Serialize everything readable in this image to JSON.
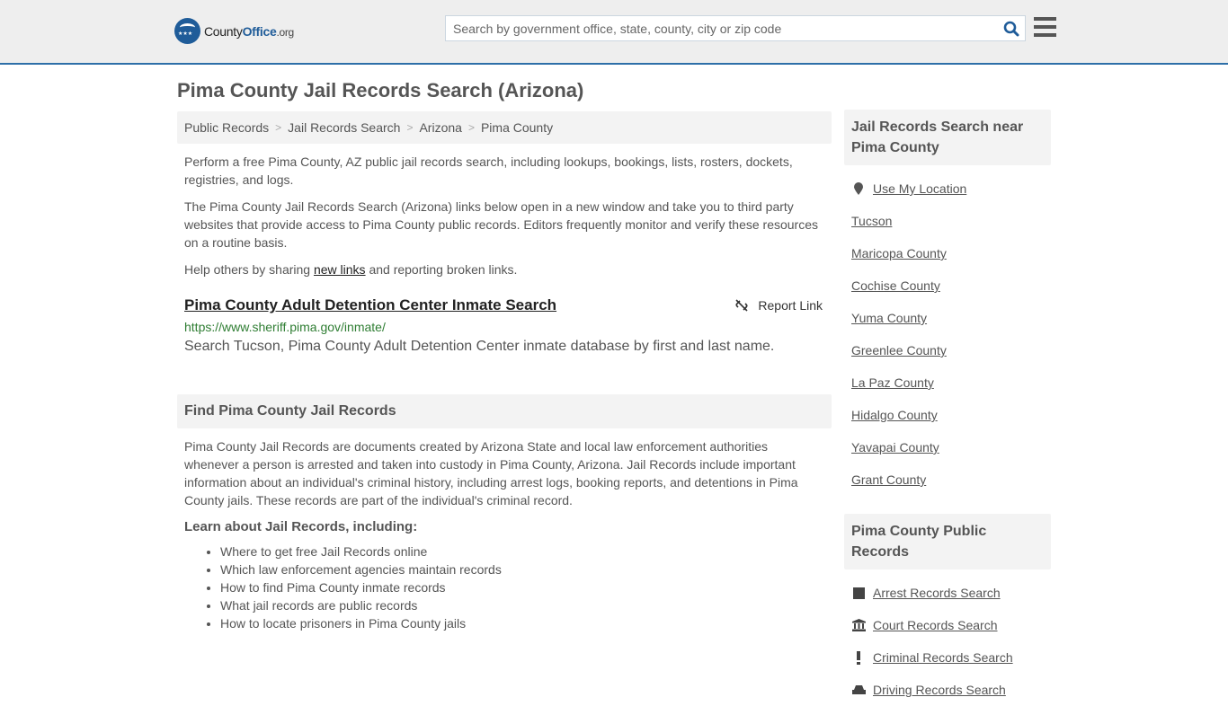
{
  "header": {
    "logo": {
      "part1": "County",
      "part2": "Office",
      "part3": ".org"
    },
    "search_placeholder": "Search by government office, state, county, city or zip code",
    "brand_color": "#1f5c99"
  },
  "page_title": "Pima County Jail Records Search (Arizona)",
  "breadcrumb": [
    {
      "label": "Public Records"
    },
    {
      "label": "Jail Records Search"
    },
    {
      "label": "Arizona"
    },
    {
      "label": "Pima County"
    }
  ],
  "intro": {
    "p1": "Perform a free Pima County, AZ public jail records search, including lookups, bookings, lists, rosters, dockets, registries, and logs.",
    "p2": "The Pima County Jail Records Search (Arizona) links below open in a new window and take you to third party websites that provide access to Pima County public records. Editors frequently monitor and verify these resources on a routine basis.",
    "p3_before": "Help others by sharing ",
    "p3_link": "new links",
    "p3_after": " and reporting broken links."
  },
  "result": {
    "title": "Pima County Adult Detention Center Inmate Search",
    "report_label": "Report Link",
    "url": "https://www.sheriff.pima.gov/inmate/",
    "description": "Search Tucson, Pima County Adult Detention Center inmate database by first and last name."
  },
  "find_section": {
    "heading": "Find Pima County Jail Records",
    "body": "Pima County Jail Records are documents created by Arizona State and local law enforcement authorities whenever a person is arrested and taken into custody in Pima County, Arizona. Jail Records include important information about an individual's criminal history, including arrest logs, booking reports, and detentions in Pima County jails. These records are part of the individual's criminal record.",
    "learn_heading": "Learn about Jail Records, including:",
    "learn_items": [
      "Where to get free Jail Records online",
      "Which law enforcement agencies maintain records",
      "How to find Pima County inmate records",
      "What jail records are public records",
      "How to locate prisoners in Pima County jails"
    ]
  },
  "sidebar": {
    "nearby_heading": "Jail Records Search near Pima County",
    "use_location": "Use My Location",
    "nearby": [
      "Tucson",
      "Maricopa County",
      "Cochise County",
      "Yuma County",
      "Greenlee County",
      "La Paz County",
      "Hidalgo County",
      "Yavapai County",
      "Grant County"
    ],
    "public_heading": "Pima County Public Records",
    "public_records": [
      {
        "label": "Arrest Records Search",
        "icon": "square-icon"
      },
      {
        "label": "Court Records Search",
        "icon": "courthouse-icon"
      },
      {
        "label": "Criminal Records Search",
        "icon": "exclamation-icon"
      },
      {
        "label": "Driving Records Search",
        "icon": "car-icon"
      }
    ]
  }
}
